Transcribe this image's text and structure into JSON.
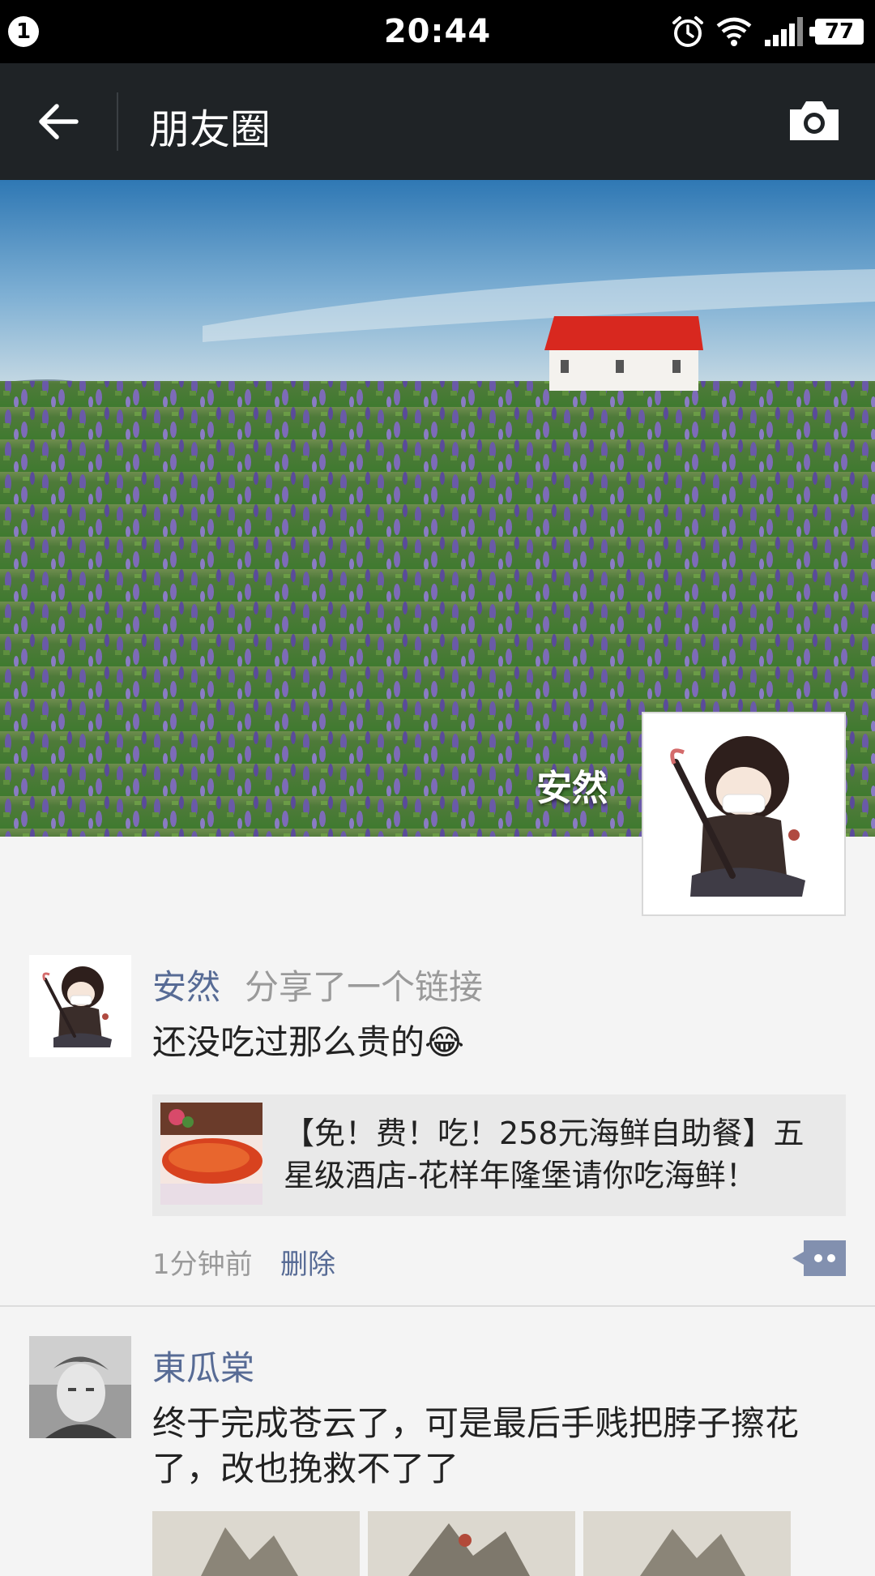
{
  "status_bar": {
    "notification_count": "1",
    "time": "20:44",
    "battery": "77",
    "icons": [
      "alarm-icon",
      "wifi-icon",
      "signal-icon",
      "battery-icon"
    ]
  },
  "title_bar": {
    "title": "朋友圈",
    "back_icon": "arrow-left-icon",
    "camera_icon": "camera-icon"
  },
  "cover": {
    "user_name": "安然"
  },
  "posts": [
    {
      "nickname": "安然",
      "action": "分享了一个链接",
      "text": "还没吃过那么贵的😂",
      "link": {
        "title": "【免！费！吃！258元海鲜自助餐】五星级酒店-花样年隆堡请你吃海鲜！"
      },
      "time": "1分钟前",
      "delete_label": "删除"
    },
    {
      "nickname": "東瓜棠",
      "text": "终于完成苍云了，可是最后手贱把脖子擦花了，改也挽救不了了"
    }
  ],
  "colors": {
    "nickname": "#576b95",
    "title_bar_bg": "#1f2326",
    "feed_bg": "#f4f4f4"
  }
}
